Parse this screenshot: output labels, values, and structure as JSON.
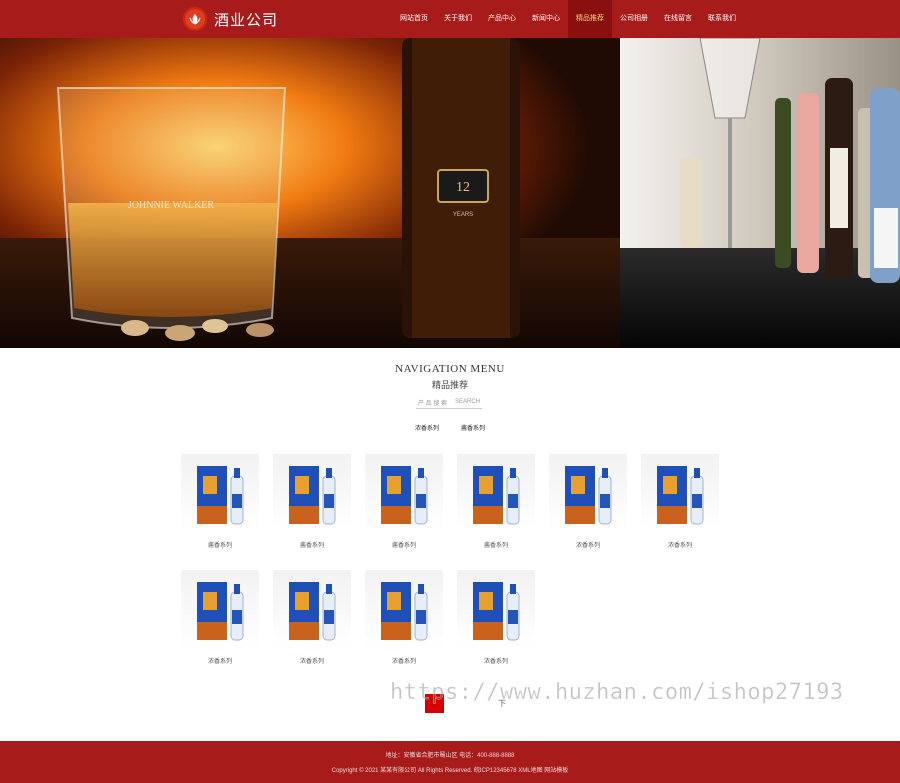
{
  "header": {
    "logo_text": "酒业公司",
    "nav": [
      {
        "label": "网站首页",
        "active": false
      },
      {
        "label": "关于我们",
        "active": false
      },
      {
        "label": "产品中心",
        "active": false
      },
      {
        "label": "新闻中心",
        "active": false
      },
      {
        "label": "精品推荐",
        "active": true
      },
      {
        "label": "公司相册",
        "active": false
      },
      {
        "label": "在线留言",
        "active": false
      },
      {
        "label": "联系我们",
        "active": false
      }
    ]
  },
  "banner": {
    "slides": 3,
    "current_slide": 2,
    "glass_brand": "JOHNNIE WALKER",
    "bottle_label_number": "12",
    "bottle_label_text": "YEARS"
  },
  "section": {
    "title_en": "NAVIGATION MENU",
    "title_cn": "精品推荐",
    "search_cn": "产 品 搜 索",
    "search_en": "SEARCH",
    "tabs": [
      "浓香系列",
      "酱香系列"
    ]
  },
  "products": [
    {
      "caption": "酱香系列"
    },
    {
      "caption": "酱香系列"
    },
    {
      "caption": "酱香系列"
    },
    {
      "caption": "酱香系列"
    },
    {
      "caption": "浓香系列"
    },
    {
      "caption": "浓香系列"
    },
    {
      "caption": "浓香系列"
    },
    {
      "caption": "浓香系列"
    },
    {
      "caption": "浓香系列"
    },
    {
      "caption": "浓香系列"
    }
  ],
  "pager": {
    "current": "1",
    "next": "下"
  },
  "watermark": "https://www.huzhan.com/ishop27193",
  "footer": {
    "line1": "地址：安徽省合肥市蜀山区 电话：400-888-8888",
    "line2": "Copyright © 2021 某某有限公司 All Rights Reserved. 皖ICP12345678 XML地图 网站模板"
  },
  "colors": {
    "brand_red": "#a81b1b",
    "pager_red": "#d60000",
    "nav_active": "#8a1010"
  }
}
